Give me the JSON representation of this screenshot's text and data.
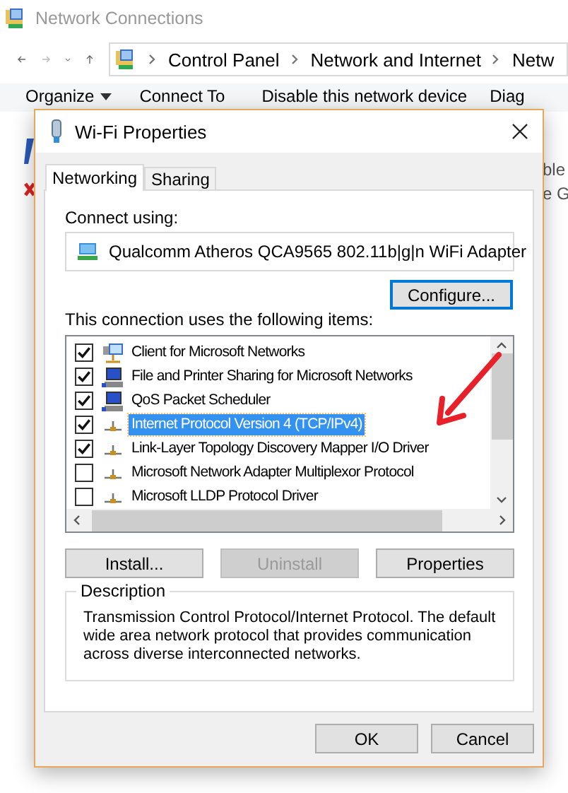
{
  "explorer": {
    "title": "Network Connections",
    "breadcrumbs": [
      "Control Panel",
      "Network and Internet",
      "Netw"
    ],
    "toolbar": [
      {
        "label": "Organize",
        "kind": "menu"
      },
      {
        "label": "Connect To",
        "kind": "plain"
      },
      {
        "label": "Disable this network device",
        "kind": "plain"
      },
      {
        "label": "Diag",
        "kind": "plain"
      }
    ],
    "side_text": [
      "ble",
      "e G"
    ]
  },
  "dialog": {
    "title": "Wi-Fi Properties",
    "tabs": [
      {
        "label": "Networking",
        "selected": true
      },
      {
        "label": "Sharing",
        "selected": false
      }
    ],
    "connect_label": "Connect using:",
    "adapter": "Qualcomm Atheros QCA9565 802.11b|g|n WiFi Adapter",
    "configure_button": "Configure...",
    "items_label": "This connection uses the following items:",
    "items": [
      {
        "label": "Client for Microsoft Networks",
        "checked": true,
        "selected": false,
        "kind": "client"
      },
      {
        "label": "File and Printer Sharing for Microsoft Networks",
        "checked": true,
        "selected": false,
        "kind": "service"
      },
      {
        "label": "QoS Packet Scheduler",
        "checked": true,
        "selected": false,
        "kind": "service"
      },
      {
        "label": "Internet Protocol Version 4 (TCP/IPv4)",
        "checked": true,
        "selected": true,
        "kind": "protocol"
      },
      {
        "label": "Link-Layer Topology Discovery Mapper I/O Driver",
        "checked": true,
        "selected": false,
        "kind": "protocol"
      },
      {
        "label": "Microsoft Network Adapter Multiplexor Protocol",
        "checked": false,
        "selected": false,
        "kind": "protocol"
      },
      {
        "label": "Microsoft LLDP Protocol Driver",
        "checked": false,
        "selected": false,
        "kind": "protocol"
      }
    ],
    "buttons": [
      {
        "label": "Install...",
        "disabled": false
      },
      {
        "label": "Uninstall",
        "disabled": true
      },
      {
        "label": "Properties",
        "disabled": false
      }
    ],
    "description": {
      "title": "Description",
      "text": "Transmission Control Protocol/Internet Protocol. The default wide area network protocol that provides communication across diverse interconnected networks."
    },
    "footer_buttons": [
      "OK",
      "Cancel"
    ]
  }
}
